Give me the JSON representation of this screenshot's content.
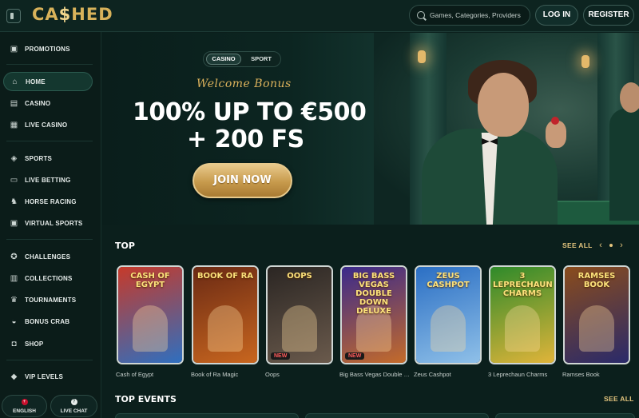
{
  "header": {
    "logo_text": "CA$HED",
    "logo_prefix": "CA",
    "logo_dollar": "$",
    "logo_suffix": "HED",
    "search_placeholder": "Games, Categories, Providers",
    "login_label": "LOG IN",
    "register_label": "REGISTER"
  },
  "sidebar": {
    "items": [
      {
        "label": "PROMOTIONS",
        "icon": "gift-icon"
      },
      {
        "label": "HOME",
        "icon": "home-icon",
        "active": true
      },
      {
        "label": "CASINO",
        "icon": "casino-icon"
      },
      {
        "label": "LIVE CASINO",
        "icon": "live-casino-icon"
      },
      {
        "label": "SPORTS",
        "icon": "sports-icon"
      },
      {
        "label": "LIVE BETTING",
        "icon": "live-betting-icon"
      },
      {
        "label": "HORSE RACING",
        "icon": "horse-icon"
      },
      {
        "label": "VIRTUAL SPORTS",
        "icon": "virtual-sports-icon"
      },
      {
        "label": "CHALLENGES",
        "icon": "medal-icon"
      },
      {
        "label": "COLLECTIONS",
        "icon": "collections-icon"
      },
      {
        "label": "TOURNAMENTS",
        "icon": "trophy-icon"
      },
      {
        "label": "BONUS CRAB",
        "icon": "crab-icon"
      },
      {
        "label": "SHOP",
        "icon": "shop-icon"
      },
      {
        "label": "VIP LEVELS",
        "icon": "diamond-icon"
      }
    ],
    "language_label": "ENGLISH",
    "live_chat_label": "LIVE CHAT"
  },
  "hero": {
    "toggle": {
      "casino": "CASINO",
      "sport": "SPORT",
      "selected": "CASINO"
    },
    "welcome": "Welcome Bonus",
    "headline_1": "100% UP TO €500",
    "headline_2": "+ 200 FS",
    "cta": "JOIN NOW"
  },
  "top": {
    "title": "TOP",
    "see_all": "SEE ALL",
    "games": [
      {
        "name": "Cash of Egypt",
        "art_title": "CASH OF EGYPT",
        "new": false,
        "colors": [
          "#c63a2a",
          "#2f6fbf"
        ]
      },
      {
        "name": "Book of Ra Magic",
        "art_title": "BOOK OF RA",
        "new": false,
        "colors": [
          "#6b2a14",
          "#c8661f"
        ]
      },
      {
        "name": "Oops",
        "art_title": "OOPS",
        "new": true,
        "new_label": "NEW",
        "colors": [
          "#2b2623",
          "#6a5a4c"
        ]
      },
      {
        "name": "Big Bass Vegas Double D...",
        "art_title": "BIG BASS VEGAS DOUBLE DOWN DELUXE",
        "new": true,
        "new_label": "NEW",
        "colors": [
          "#3b2a8c",
          "#c46b2a"
        ]
      },
      {
        "name": "Zeus Cashpot",
        "art_title": "ZEUS CASHPOT",
        "new": false,
        "colors": [
          "#2b6fc4",
          "#8fc0e8"
        ]
      },
      {
        "name": "3 Leprechaun Charms",
        "art_title": "3 LEPRECHAUN CHARMS",
        "new": false,
        "colors": [
          "#2e8a2a",
          "#e0b43a"
        ]
      },
      {
        "name": "Ramses Book",
        "art_title": "RAMSES BOOK",
        "new": false,
        "colors": [
          "#8a4c1c",
          "#2a2a6a"
        ]
      }
    ]
  },
  "top_events": {
    "title": "TOP EVENTS",
    "see_all": "SEE ALL"
  },
  "colors": {
    "accent_gold": "#dcb25c",
    "background": "#0b1f1c",
    "new_badge": "#ff5a5a"
  }
}
